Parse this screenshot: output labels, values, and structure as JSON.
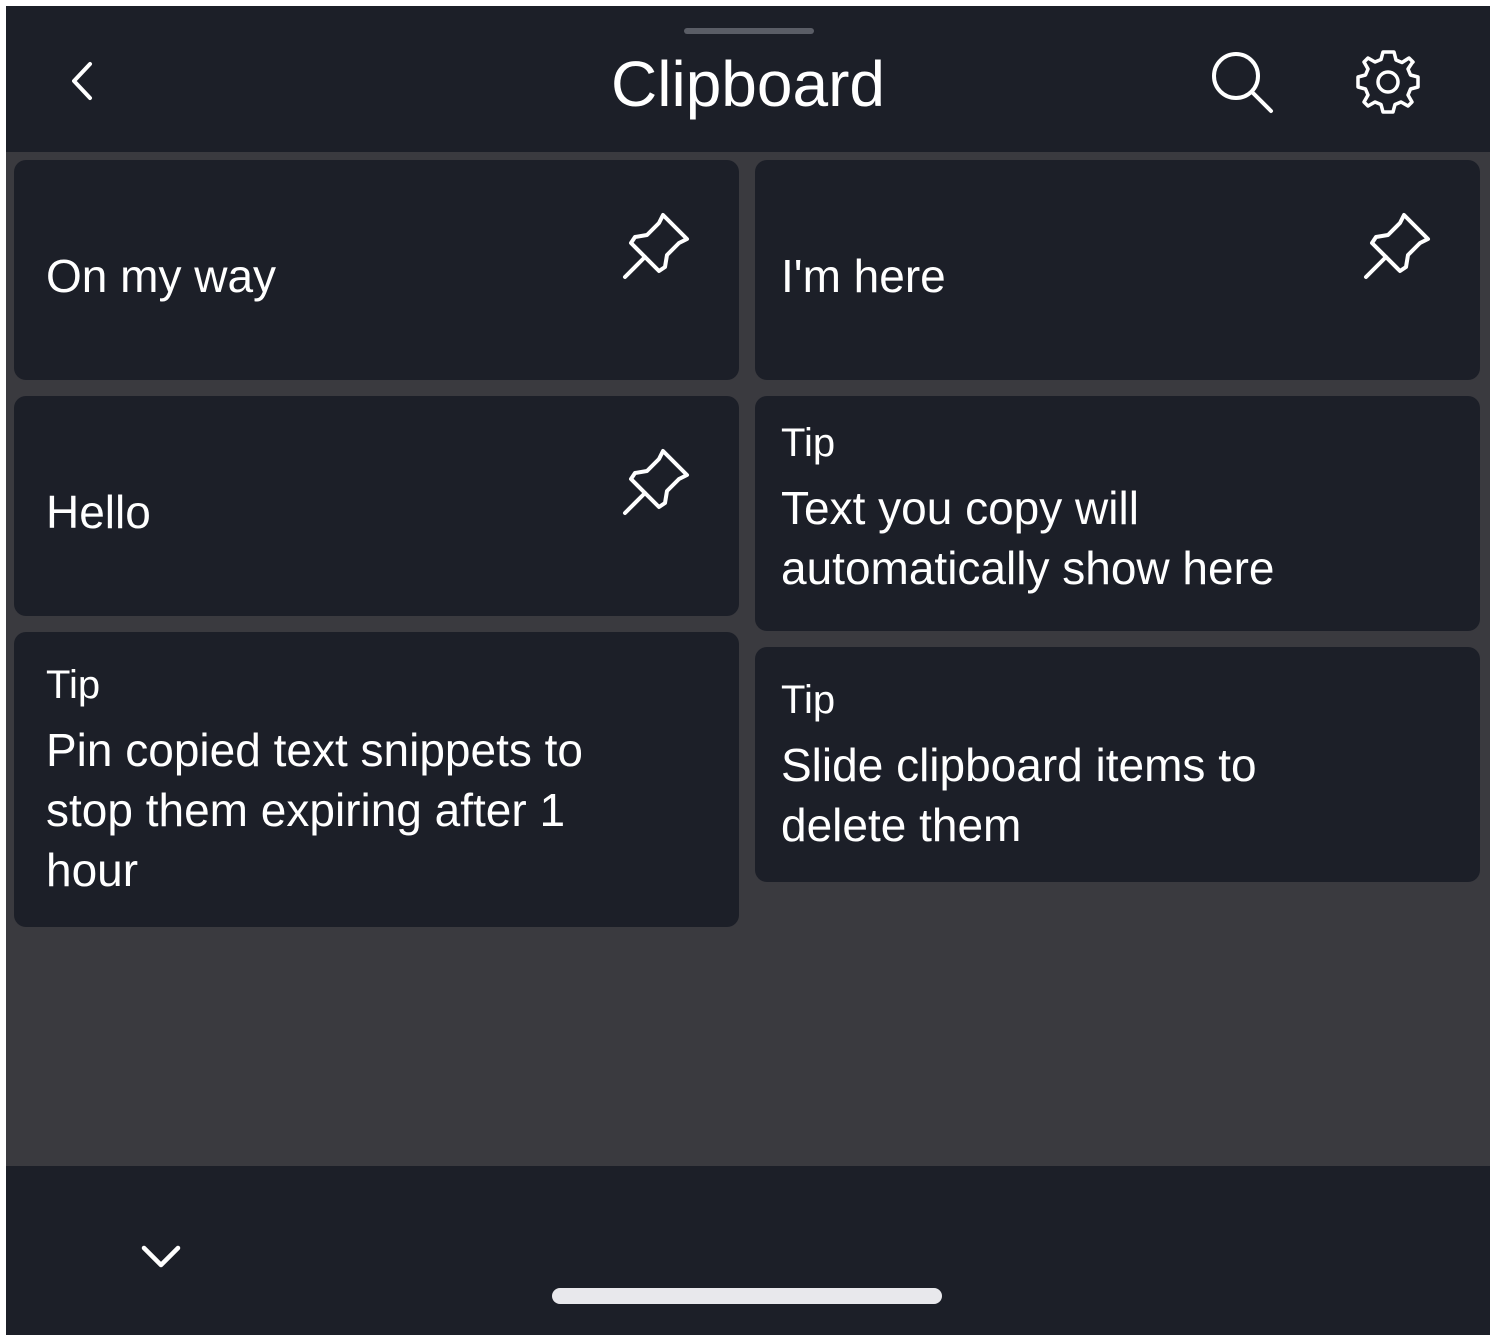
{
  "header": {
    "title": "Clipboard",
    "back_icon": "chevron-left-icon",
    "search_icon": "search-icon",
    "settings_icon": "gear-icon"
  },
  "items": [
    {
      "text": "On my way",
      "pinned": true
    },
    {
      "text": "I'm here",
      "pinned": true
    },
    {
      "text": "Hello",
      "pinned": true
    }
  ],
  "tips": [
    {
      "label": "Tip",
      "text": "Text you copy will automatically show here"
    },
    {
      "label": "Tip",
      "text": "Pin copied text snippets to stop them expiring after 1 hour"
    },
    {
      "label": "Tip",
      "text": "Slide clipboard items to delete them"
    }
  ],
  "footer": {
    "collapse_icon": "chevron-down-icon"
  },
  "colors": {
    "surface": "#1c1f28",
    "background": "#3a3a3f",
    "text": "#ffffff"
  }
}
